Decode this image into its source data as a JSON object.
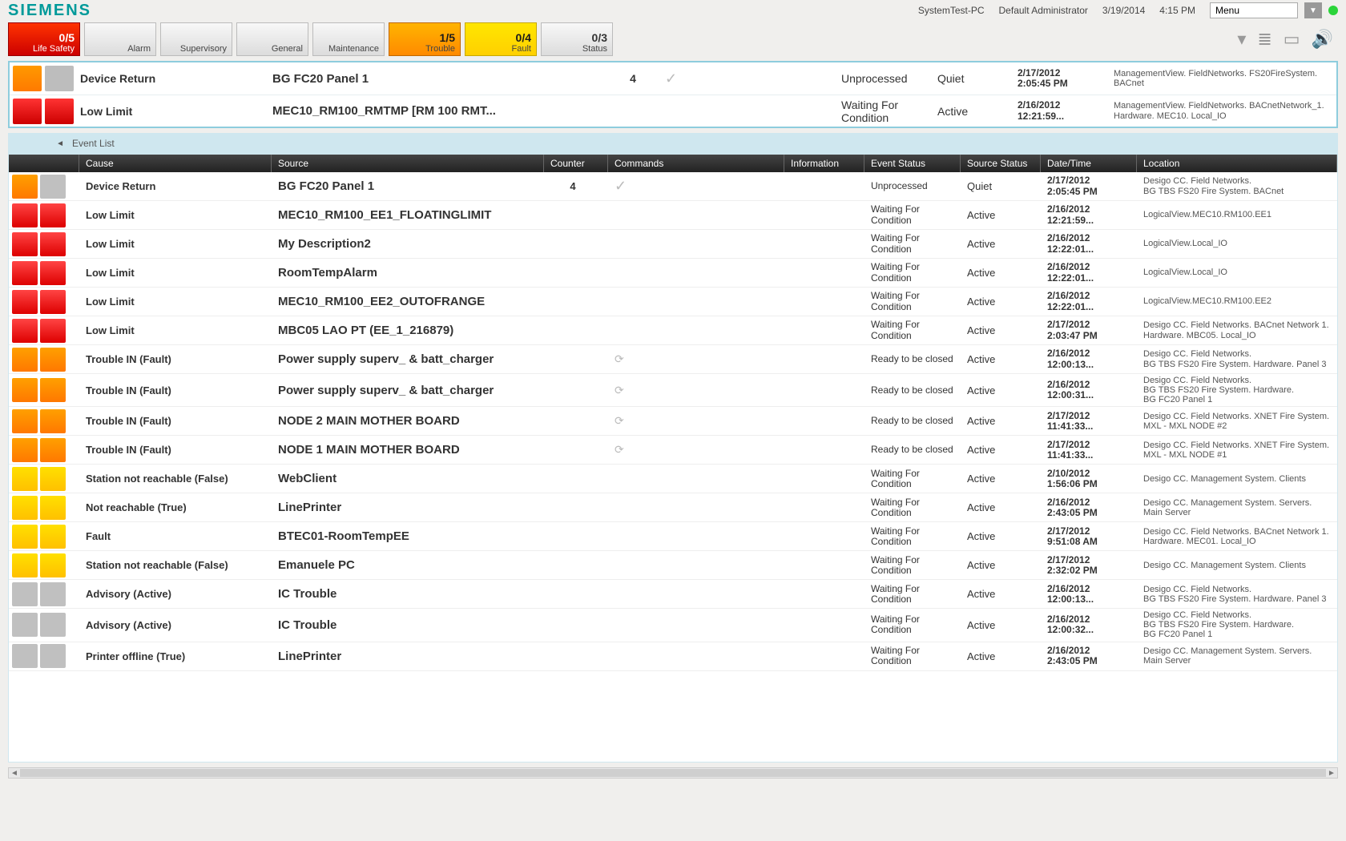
{
  "header": {
    "brand": "SIEMENS",
    "host": "SystemTest-PC",
    "user": "Default Administrator",
    "date": "3/19/2014",
    "time": "4:15 PM",
    "menu_label": "Menu"
  },
  "categories": [
    {
      "count": "0/5",
      "label": "Life Safety",
      "cls": "life"
    },
    {
      "count": "",
      "label": "Alarm",
      "cls": ""
    },
    {
      "count": "",
      "label": "Supervisory",
      "cls": ""
    },
    {
      "count": "",
      "label": "General",
      "cls": ""
    },
    {
      "count": "",
      "label": "Maintenance",
      "cls": ""
    },
    {
      "count": "1/5",
      "label": "Trouble",
      "cls": "trouble"
    },
    {
      "count": "0/4",
      "label": "Fault",
      "cls": "fault"
    },
    {
      "count": "0/3",
      "label": "Status",
      "cls": ""
    }
  ],
  "summary": [
    {
      "icons": [
        "orange",
        "gray"
      ],
      "cause": "Device Return",
      "source": "BG FC20 Panel 1",
      "counter": "4",
      "cmd": "✓",
      "estat": "Unprocessed",
      "sstat": "Quiet",
      "date": "2/17/2012",
      "time": "2:05:45 PM",
      "loc": "ManagementView. FieldNetworks. FS20FireSystem. BACnet"
    },
    {
      "icons": [
        "red",
        "red"
      ],
      "cause": "Low Limit",
      "source": "MEC10_RM100_RMTMP [RM 100 RMT...",
      "counter": "",
      "cmd": "",
      "estat": "Waiting For Condition",
      "sstat": "Active",
      "date": "2/16/2012",
      "time": "12:21:59...",
      "loc": "ManagementView. FieldNetworks. BACnetNetwork_1. Hardware. MEC10. Local_IO"
    }
  ],
  "list_title": "Event List",
  "columns": {
    "cause": "Cause",
    "source": "Source",
    "counter": "Counter",
    "cmd": "Commands",
    "info": "Information",
    "estat": "Event Status",
    "sstat": "Source Status",
    "date": "Date/Time",
    "loc": "Location"
  },
  "rows": [
    {
      "ic": [
        "or2",
        "gr2"
      ],
      "cause": "Device Return",
      "source": "BG FC20 Panel 1",
      "counter": "4",
      "cmd": "✓",
      "estat": "Unprocessed",
      "sstat": "Quiet",
      "date": "2/17/2012",
      "time": "2:05:45 PM",
      "loc": "Desigo CC. Field Networks.\nBG TBS FS20 Fire System. BACnet"
    },
    {
      "ic": [
        "red2",
        "red2"
      ],
      "cause": "Low Limit",
      "source": "MEC10_RM100_EE1_FLOATINGLIMIT",
      "counter": "",
      "cmd": "",
      "estat": "Waiting For Condition",
      "sstat": "Active",
      "date": "2/16/2012",
      "time": "12:21:59...",
      "loc": "LogicalView.MEC10.RM100.EE1"
    },
    {
      "ic": [
        "red2",
        "red2"
      ],
      "cause": "Low Limit",
      "source": "My Description2",
      "counter": "",
      "cmd": "",
      "estat": "Waiting For Condition",
      "sstat": "Active",
      "date": "2/16/2012",
      "time": "12:22:01...",
      "loc": "LogicalView.Local_IO"
    },
    {
      "ic": [
        "red2",
        "red2"
      ],
      "cause": "Low Limit",
      "source": "RoomTempAlarm",
      "counter": "",
      "cmd": "",
      "estat": "Waiting For Condition",
      "sstat": "Active",
      "date": "2/16/2012",
      "time": "12:22:01...",
      "loc": "LogicalView.Local_IO"
    },
    {
      "ic": [
        "red2",
        "red2"
      ],
      "cause": "Low Limit",
      "source": "MEC10_RM100_EE2_OUTOFRANGE",
      "counter": "",
      "cmd": "",
      "estat": "Waiting For Condition",
      "sstat": "Active",
      "date": "2/16/2012",
      "time": "12:22:01...",
      "loc": "LogicalView.MEC10.RM100.EE2"
    },
    {
      "ic": [
        "red2",
        "red2"
      ],
      "cause": "Low Limit",
      "source": "MBC05 LAO PT (EE_1_216879)",
      "counter": "",
      "cmd": "",
      "estat": "Waiting For Condition",
      "sstat": "Active",
      "date": "2/17/2012",
      "time": "2:03:47 PM",
      "loc": "Desigo CC. Field Networks. BACnet Network 1. Hardware. MBC05. Local_IO"
    },
    {
      "ic": [
        "or2",
        "or2"
      ],
      "cause": "Trouble IN (Fault)",
      "source": "Power supply superv_ & batt_charger",
      "counter": "",
      "cmd": "⟳",
      "estat": "Ready to be closed",
      "sstat": "Active",
      "date": "2/16/2012",
      "time": "12:00:13...",
      "loc": "Desigo CC. Field Networks.\nBG TBS FS20 Fire System. Hardware. Panel 3"
    },
    {
      "ic": [
        "or2",
        "or2"
      ],
      "cause": "Trouble IN (Fault)",
      "source": "Power supply superv_ & batt_charger",
      "counter": "",
      "cmd": "⟳",
      "estat": "Ready to be closed",
      "sstat": "Active",
      "date": "2/16/2012",
      "time": "12:00:31...",
      "loc": "Desigo CC. Field Networks.\nBG TBS FS20 Fire System. Hardware.\nBG FC20 Panel 1"
    },
    {
      "ic": [
        "or2",
        "or2"
      ],
      "cause": "Trouble IN (Fault)",
      "source": "NODE 2 MAIN MOTHER BOARD",
      "counter": "",
      "cmd": "⟳",
      "estat": "Ready to be closed",
      "sstat": "Active",
      "date": "2/17/2012",
      "time": "11:41:33...",
      "loc": "Desigo CC. Field Networks. XNET Fire System. MXL - MXL NODE #2"
    },
    {
      "ic": [
        "or2",
        "or2"
      ],
      "cause": "Trouble IN (Fault)",
      "source": "NODE 1 MAIN MOTHER BOARD",
      "counter": "",
      "cmd": "⟳",
      "estat": "Ready to be closed",
      "sstat": "Active",
      "date": "2/17/2012",
      "time": "11:41:33...",
      "loc": "Desigo CC. Field Networks. XNET Fire System. MXL - MXL NODE #1"
    },
    {
      "ic": [
        "yl",
        "yl"
      ],
      "cause": "Station not reachable (False)",
      "source": "WebClient",
      "counter": "",
      "cmd": "",
      "estat": "Waiting For Condition",
      "sstat": "Active",
      "date": "2/10/2012",
      "time": "1:56:06 PM",
      "loc": "Desigo CC. Management System. Clients"
    },
    {
      "ic": [
        "yl",
        "yl"
      ],
      "cause": "Not reachable (True)",
      "source": "LinePrinter",
      "counter": "",
      "cmd": "",
      "estat": "Waiting For Condition",
      "sstat": "Active",
      "date": "2/16/2012",
      "time": "2:43:05 PM",
      "loc": "Desigo CC. Management System. Servers. Main Server"
    },
    {
      "ic": [
        "yl",
        "yl"
      ],
      "cause": "Fault",
      "source": "BTEC01-RoomTempEE",
      "counter": "",
      "cmd": "",
      "estat": "Waiting For Condition",
      "sstat": "Active",
      "date": "2/17/2012",
      "time": "9:51:08 AM",
      "loc": "Desigo CC. Field Networks. BACnet Network 1. Hardware. MEC01. Local_IO"
    },
    {
      "ic": [
        "yl",
        "yl"
      ],
      "cause": "Station not reachable (False)",
      "source": "Emanuele PC",
      "counter": "",
      "cmd": "",
      "estat": "Waiting For Condition",
      "sstat": "Active",
      "date": "2/17/2012",
      "time": "2:32:02 PM",
      "loc": "Desigo CC. Management System. Clients"
    },
    {
      "ic": [
        "gr2",
        "gr2"
      ],
      "cause": "Advisory (Active)",
      "source": "IC Trouble",
      "counter": "",
      "cmd": "",
      "estat": "Waiting For Condition",
      "sstat": "Active",
      "date": "2/16/2012",
      "time": "12:00:13...",
      "loc": "Desigo CC. Field Networks.\nBG TBS FS20 Fire System. Hardware. Panel 3"
    },
    {
      "ic": [
        "gr2",
        "gr2"
      ],
      "cause": "Advisory (Active)",
      "source": "IC Trouble",
      "counter": "",
      "cmd": "",
      "estat": "Waiting For Condition",
      "sstat": "Active",
      "date": "2/16/2012",
      "time": "12:00:32...",
      "loc": "Desigo CC. Field Networks.\nBG TBS FS20 Fire System. Hardware.\nBG FC20 Panel 1"
    },
    {
      "ic": [
        "gr2",
        "gr2"
      ],
      "cause": "Printer offline (True)",
      "source": "LinePrinter",
      "counter": "",
      "cmd": "",
      "estat": "Waiting For Condition",
      "sstat": "Active",
      "date": "2/16/2012",
      "time": "2:43:05 PM",
      "loc": "Desigo CC. Management System. Servers. Main Server"
    }
  ]
}
